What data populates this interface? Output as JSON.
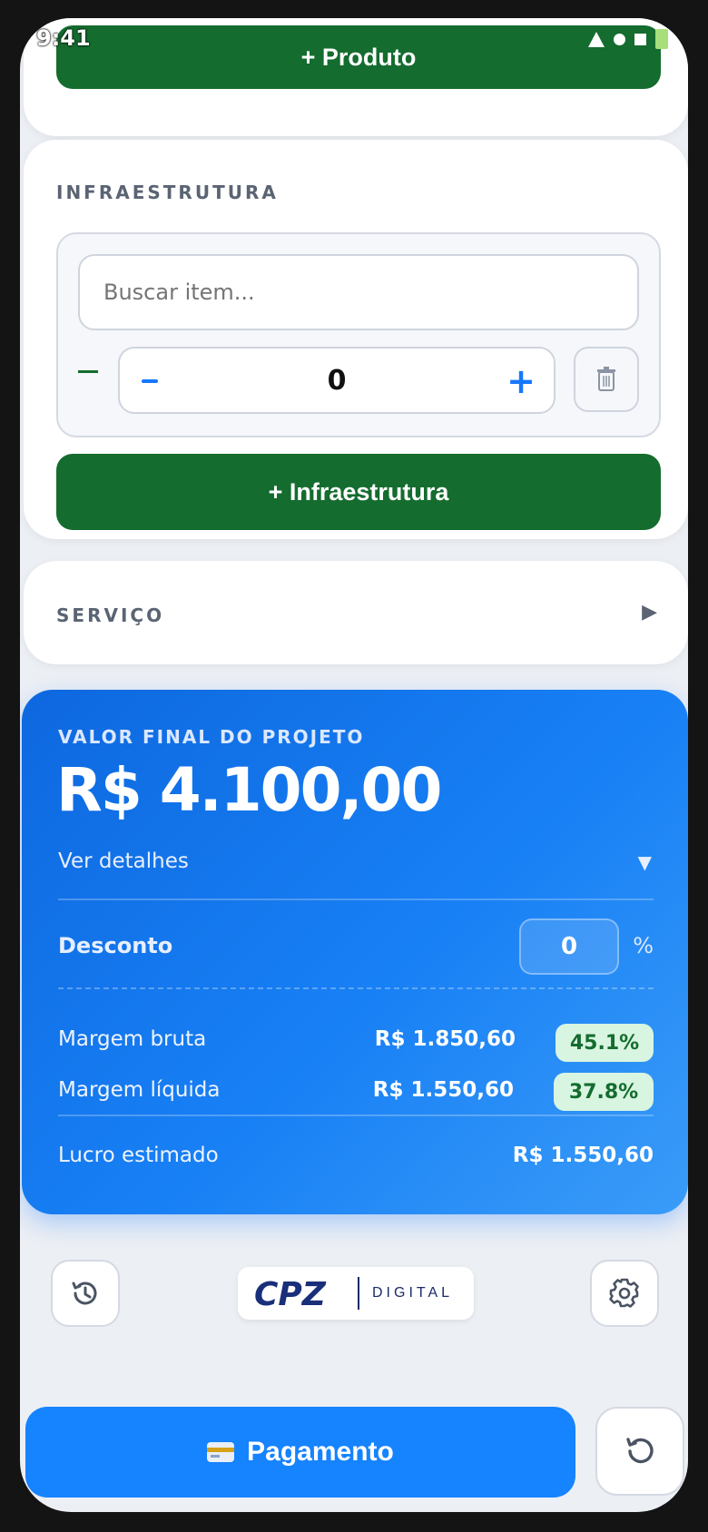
{
  "status": {
    "time": "9:41"
  },
  "produto": {
    "add_label": "+ Produto"
  },
  "infra": {
    "title": "INFRAESTRUTURA",
    "search_placeholder": "Buscar item...",
    "quantity": "0",
    "add_label": "+ Infraestrutura"
  },
  "servico": {
    "title": "SERVIÇO"
  },
  "summary": {
    "label": "VALOR FINAL DO PROJETO",
    "value": "R$ 4.100,00",
    "details": "Ver detalhes",
    "discount_label": "Desconto",
    "discount_value": "0",
    "discount_unit": "%",
    "gross_margin_label": "Margem bruta",
    "gross_margin_value": "R$ 1.850,60",
    "gross_margin_pct": "45.1%",
    "net_margin_label": "Margem líquida",
    "net_margin_value": "R$ 1.550,60",
    "net_margin_pct": "37.8%",
    "profit_label": "Lucro estimado",
    "profit_value": "R$ 1.550,60"
  },
  "brand": {
    "logo_text": "CPZ",
    "logo_sub": "DIGITAL"
  },
  "payment": {
    "label": "Pagamento"
  },
  "colors": {
    "green": "#146c2e",
    "blue": "#1683ff",
    "pill": "#d8f5e1"
  },
  "icons": {
    "history": "history-icon",
    "settings": "gear-icon",
    "reset": "reset-icon",
    "trash": "trash-icon",
    "card": "credit-card-icon"
  }
}
